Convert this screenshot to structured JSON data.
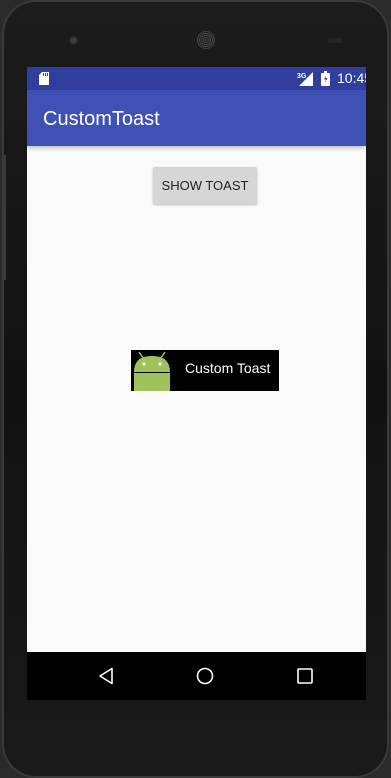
{
  "status_bar": {
    "time": "10:45",
    "network": "3G",
    "icons": [
      "sd-card-icon",
      "signal-icon",
      "battery-icon"
    ]
  },
  "app_bar": {
    "title": "CustomToast",
    "color": "#3f51b5",
    "status_color": "#303f9f"
  },
  "main": {
    "show_toast_label": "SHOW TOAST"
  },
  "toast": {
    "text": "Custom Toast",
    "icon": "android-icon",
    "android_color": "#9fc35a"
  },
  "nav_bar": {
    "icons": [
      "back-icon",
      "home-icon",
      "recents-icon"
    ]
  }
}
